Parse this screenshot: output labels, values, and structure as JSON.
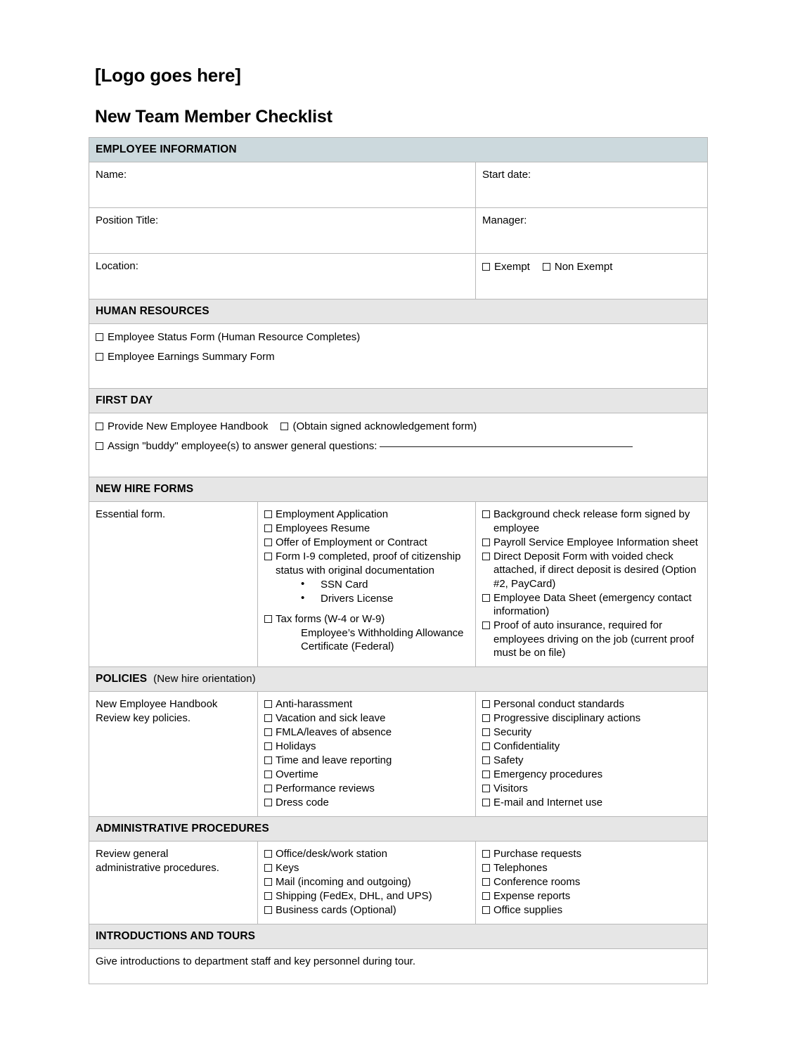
{
  "header": {
    "logo_placeholder": "[Logo goes here]",
    "title": "New Team Member Checklist"
  },
  "colors": {
    "employee_info_header_bg": "#ccd9dd",
    "section_header_bg": "#e6e6e6",
    "border": "#b8b8b8",
    "text": "#000000"
  },
  "sections": {
    "employee_information": {
      "heading": "EMPLOYEE INFORMATION",
      "fields": [
        {
          "left_label": "Name:",
          "right_label": "Start date:"
        },
        {
          "left_label": "Position Title:",
          "right_label": "Manager:"
        }
      ],
      "location_label": "Location:",
      "exempt_options": [
        "Exempt",
        "Non Exempt"
      ]
    },
    "human_resources": {
      "heading": "HUMAN RESOURCES",
      "items": [
        "Employee Status Form  (Human Resource Completes)",
        "Employee Earnings Summary Form"
      ]
    },
    "first_day": {
      "heading": "FIRST DAY",
      "item1a": "Provide New Employee Handbook",
      "item1b": "(Obtain signed acknowledgement form)",
      "item2": "Assign \"buddy\" employee(s) to answer general questions:"
    },
    "new_hire_forms": {
      "heading": "NEW HIRE FORMS",
      "col1_label": "Essential form.",
      "col2_items": [
        "Employment Application",
        "Employees Resume",
        "Offer of Employment or Contract",
        "Form I-9 completed, proof of citizenship status with original documentation"
      ],
      "col2_bullets": [
        "SSN Card",
        "Drivers License"
      ],
      "col2_tax_item": "Tax forms (W-4 or W-9)",
      "col2_tax_sub": "Employee’s Withholding Allowance Certificate (Federal)",
      "col3_items": [
        "Background check release form signed by employee",
        "Payroll Service Employee Information sheet",
        "Direct Deposit Form with voided check attached, if direct deposit is desired  (Option #2, PayCard)",
        "Employee Data Sheet (emergency contact information)",
        "Proof of auto insurance, required for employees driving on the job (current proof must be on file)"
      ]
    },
    "policies": {
      "heading": "POLICIES",
      "heading_sub": "(New hire orientation)",
      "col1_label_line1": "New Employee Handbook",
      "col1_label_line2": "Review key policies.",
      "col2_items": [
        "Anti-harassment",
        "Vacation and sick leave",
        "FMLA/leaves of absence",
        "Holidays",
        "Time and leave reporting",
        "Overtime",
        "Performance reviews",
        "Dress code"
      ],
      "col3_items": [
        "Personal conduct standards",
        "Progressive disciplinary actions",
        "Security",
        "Confidentiality",
        "Safety",
        "Emergency procedures",
        "Visitors",
        "E-mail and Internet use"
      ]
    },
    "administrative_procedures": {
      "heading": "ADMINISTRATIVE PROCEDURES",
      "col1_label_line1": "Review general",
      "col1_label_line2": "administrative procedures.",
      "col2_items": [
        "Office/desk/work station",
        "Keys",
        "Mail (incoming and outgoing)",
        "Shipping (FedEx, DHL, and UPS)",
        "Business cards (Optional)"
      ],
      "col3_items": [
        "Purchase requests",
        "Telephones",
        "Conference rooms",
        "Expense reports",
        "Office supplies"
      ]
    },
    "introductions_and_tours": {
      "heading": "INTRODUCTIONS AND TOURS",
      "body": "Give introductions to department staff and key personnel during tour."
    }
  }
}
